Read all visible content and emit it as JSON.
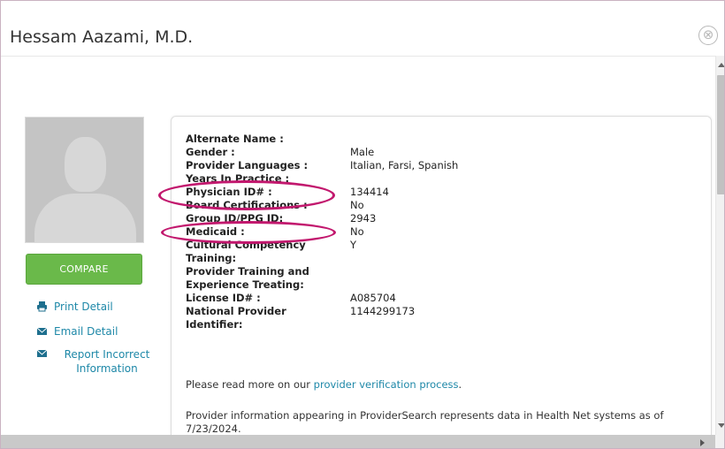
{
  "modal": {
    "title": "Hessam Aazami, M.D.",
    "close_glyph": "⊗"
  },
  "sidebar": {
    "compare_label": "COMPARE",
    "links": [
      {
        "icon": "printer-icon",
        "label": "Print Detail"
      },
      {
        "icon": "envelope-icon",
        "label": "Email Detail"
      },
      {
        "icon": "envelope-icon",
        "label": "Report Incorrect Information"
      }
    ]
  },
  "details": [
    {
      "label": "Alternate Name :",
      "value": ""
    },
    {
      "label": "Gender :",
      "value": "Male"
    },
    {
      "label": "Provider Languages :",
      "value": "Italian, Farsi, Spanish"
    },
    {
      "label": "Years In Practice :",
      "value": ""
    },
    {
      "label": "Physician ID# :",
      "value": "134414"
    },
    {
      "label": "Board Certifications :",
      "value": "No"
    },
    {
      "label": "Group ID/PPG ID:",
      "value": "2943"
    },
    {
      "label": "Medicaid :",
      "value": "No"
    },
    {
      "label": "Cultural Competency Training:",
      "value": "Y"
    },
    {
      "label": "Provider Training and Experience Treating:",
      "value": ""
    },
    {
      "label": "License ID# :",
      "value": "A085704"
    },
    {
      "label": "National Provider Identifier:",
      "value": "1144299173"
    }
  ],
  "notes": {
    "verification_prefix": "Please read more on our ",
    "verification_link": "provider verification process",
    "verification_suffix": ".",
    "data_notice": "Provider information appearing in ProviderSearch represents data in Health Net systems as of 7/23/2024."
  },
  "colors": {
    "accent_green": "#6ab94a",
    "link_blue": "#1e88a8",
    "annotation_magenta": "#c2186e"
  }
}
